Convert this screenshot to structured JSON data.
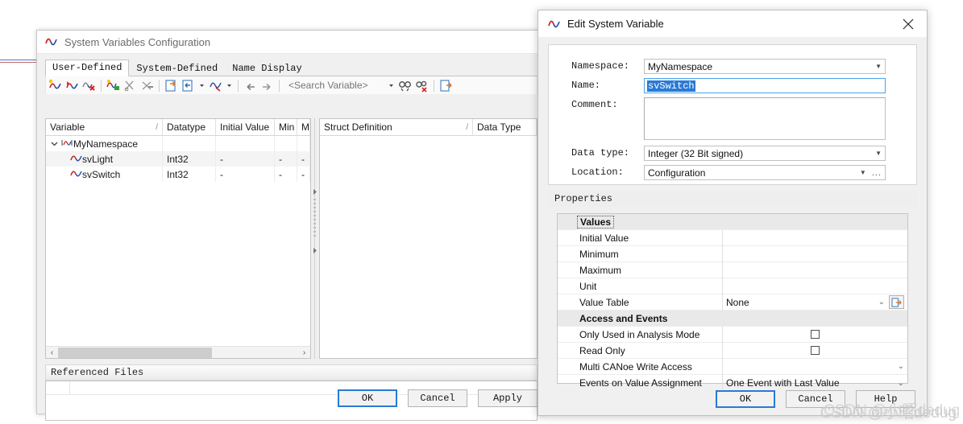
{
  "artifact": {
    "name": "stray-window-edge-lines"
  },
  "sysvar_window": {
    "title": "System Variables Configuration",
    "icon": "wave-icon",
    "tabs": [
      {
        "label": "User-Defined",
        "active": true
      },
      {
        "label": "System-Defined",
        "active": false
      },
      {
        "label": "Name Display",
        "active": false
      }
    ],
    "toolbar": {
      "icons": [
        "new-variable-icon",
        "new-variable-group-icon",
        "delete-variable-icon",
        "new-namespace-icon",
        "cut-icon",
        "paste-icon",
        "import-icon",
        "export-icon",
        "export-dropdown-icon",
        "settings-icon",
        "settings-dropdown-icon",
        "undo-icon",
        "redo-icon",
        "find-icon",
        "find-clear-icon",
        "options-icon"
      ],
      "search_placeholder": "<Search Variable>",
      "search_value": ""
    },
    "variables_grid": {
      "columns": [
        "Variable",
        "Datatype",
        "Initial Value",
        "Min",
        "M"
      ],
      "sort_column_marker": "/",
      "rows": [
        {
          "indent": 0,
          "icon": "namespace-icon",
          "twisty": "chevron-down-icon",
          "name": "MyNamespace",
          "datatype": "",
          "initial_value": "",
          "min": "",
          "max": ""
        },
        {
          "indent": 1,
          "icon": "variable-icon",
          "twisty": "",
          "name": "svLight",
          "datatype": "Int32",
          "initial_value": "-",
          "min": "-",
          "max": "-"
        },
        {
          "indent": 1,
          "icon": "variable-icon",
          "twisty": "",
          "name": "svSwitch",
          "datatype": "Int32",
          "initial_value": "-",
          "min": "-",
          "max": "-"
        }
      ],
      "hscroll_left_arrow": "‹",
      "hscroll_right_arrow": "›"
    },
    "struct_grid": {
      "columns": [
        "Struct Definition",
        "Data Type"
      ],
      "sort_column_marker": "/",
      "rows": []
    },
    "referenced_files": {
      "header": "Referenced Files",
      "rows": []
    },
    "buttons": [
      {
        "label": "OK",
        "default": true
      },
      {
        "label": "Cancel",
        "default": false
      },
      {
        "label": "Apply",
        "default": false
      }
    ]
  },
  "edit_dialog": {
    "title": "Edit System Variable",
    "icon": "wave-icon",
    "close_icon": "close-icon",
    "fields": {
      "namespace_label": "Namespace:",
      "namespace_value": "MyNamespace",
      "name_label": "Name:",
      "name_value": "svSwitch",
      "comment_label": "Comment:",
      "comment_value": "",
      "datatype_label": "Data type:",
      "datatype_value": "Integer (32 Bit signed)",
      "location_label": "Location:",
      "location_value": "Configuration",
      "location_ellipsis": "..."
    },
    "properties_header": "Properties",
    "property_groups": [
      {
        "group": "Values",
        "focused": true,
        "rows": [
          {
            "name": "Initial Value",
            "value": "",
            "control": "text"
          },
          {
            "name": "Minimum",
            "value": "",
            "control": "text"
          },
          {
            "name": "Maximum",
            "value": "",
            "control": "text"
          },
          {
            "name": "Unit",
            "value": "",
            "control": "text"
          },
          {
            "name": "Value Table",
            "value": "None",
            "control": "combo-with-button",
            "button_icon": "value-table-edit-icon"
          }
        ]
      },
      {
        "group": "Access and Events",
        "focused": false,
        "rows": [
          {
            "name": "Only Used in Analysis Mode",
            "value": "",
            "control": "checkbox",
            "checked": false
          },
          {
            "name": "Read Only",
            "value": "",
            "control": "checkbox",
            "checked": false
          },
          {
            "name": "Multi CANoe Write Access",
            "value": "",
            "control": "combo"
          },
          {
            "name": "Events on Value Assignment",
            "value": "One Event with Last Value",
            "control": "combo"
          }
        ]
      }
    ],
    "buttons": [
      {
        "label": "OK",
        "default": true
      },
      {
        "label": "Cancel",
        "default": false
      },
      {
        "label": "Help",
        "default": false
      }
    ]
  },
  "watermark": {
    "text": "CSDN @小昭dedug"
  }
}
